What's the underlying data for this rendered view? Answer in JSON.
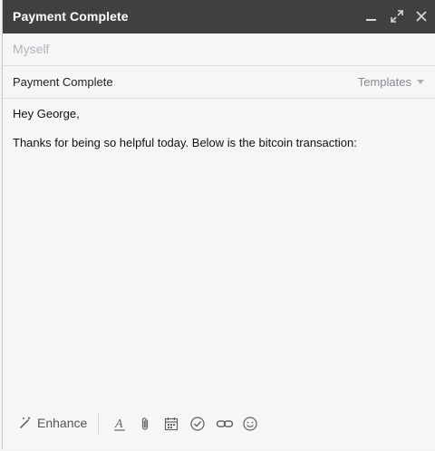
{
  "window": {
    "title": "Payment Complete",
    "controls": {
      "minimize_icon": "minimize-icon",
      "expand_icon": "expand-icon",
      "close_icon": "close-icon"
    }
  },
  "to": {
    "placeholder": "Myself"
  },
  "subject": {
    "value": "Payment Complete",
    "templates_label": "Templates"
  },
  "body": {
    "greeting": "Hey George,",
    "line1": "Thanks for being so helpful today. Below is the bitcoin transaction:"
  },
  "toolbar": {
    "enhance_label": "Enhance",
    "icons": [
      "magic-wand-icon",
      "text-format-icon",
      "paperclip-icon",
      "calendar-icon",
      "checkmark-circle-icon",
      "link-icon",
      "emoji-icon"
    ]
  },
  "colors": {
    "titlebar": "#404040",
    "background": "#f7f5f8",
    "placeholder": "#b5b3b7"
  }
}
